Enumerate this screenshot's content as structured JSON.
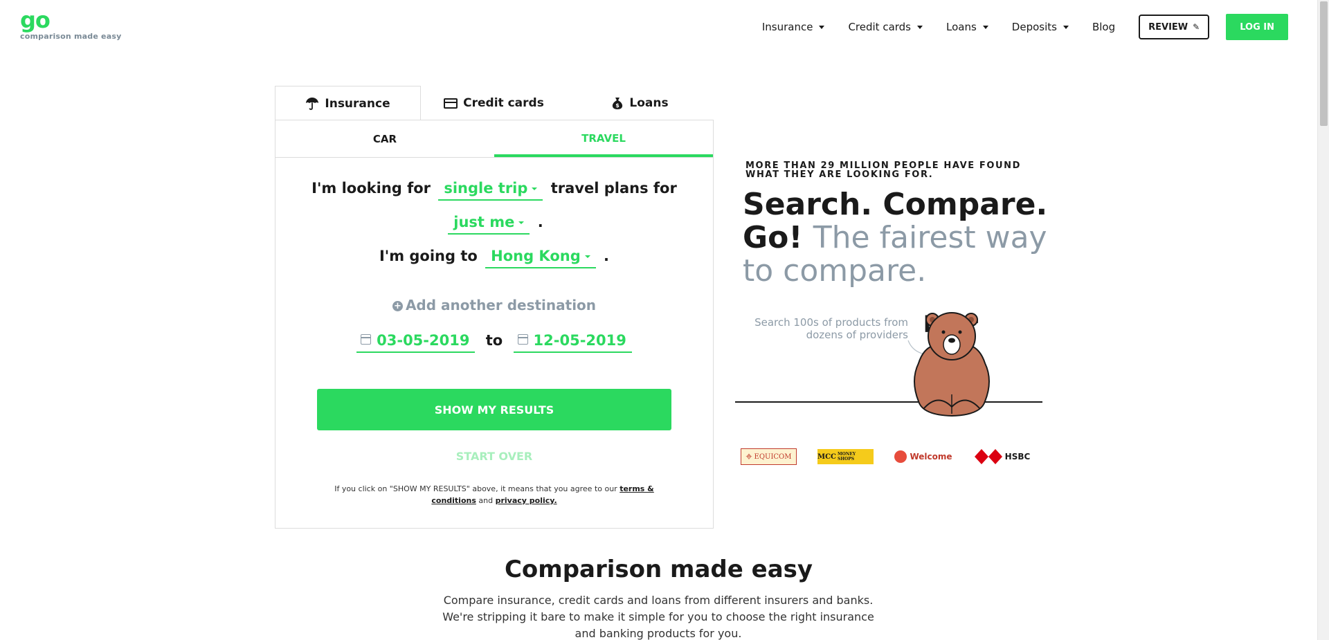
{
  "brand": {
    "logo_go": "go",
    "logo_bear": "bear",
    "tagline": "comparison made easy"
  },
  "nav": {
    "items": [
      {
        "label": "Insurance",
        "dropdown": true
      },
      {
        "label": "Credit cards",
        "dropdown": true
      },
      {
        "label": "Loans",
        "dropdown": true
      },
      {
        "label": "Deposits",
        "dropdown": true
      },
      {
        "label": "Blog",
        "dropdown": false
      }
    ],
    "review_label": "REVIEW",
    "login_label": "LOG IN"
  },
  "search": {
    "main_tabs": [
      {
        "label": "Insurance",
        "icon": "umbrella-icon",
        "active": true
      },
      {
        "label": "Credit cards",
        "icon": "credit-card-icon",
        "active": false
      },
      {
        "label": "Loans",
        "icon": "money-bag-icon",
        "active": false
      }
    ],
    "sub_tabs": [
      {
        "label": "CAR",
        "active": false
      },
      {
        "label": "TRAVEL",
        "active": true
      }
    ],
    "sentence1_prefix": "I'm looking for",
    "trip_type": "single trip",
    "sentence1_suffix": "travel plans for",
    "travellers": "just me",
    "sentence2_suffix": ".",
    "sentence3_prefix": "I'm going to",
    "destination": "Hong Kong",
    "sentence3_suffix": ".",
    "add_destination": "Add another destination",
    "start_date": "03-05-2019",
    "to_label": "to",
    "end_date": "12-05-2019",
    "submit_label": "SHOW MY RESULTS",
    "start_over_label": "START OVER",
    "legal_prefix": "If you click on \"SHOW MY RESULTS\" above, it means that you agree to our",
    "terms_link": "terms & conditions",
    "legal_and": "and",
    "privacy_link": "privacy policy."
  },
  "hero": {
    "kicker": "MORE THAN 29 MILLION PEOPLE HAVE FOUND WHAT THEY ARE LOOKING FOR.",
    "title_bold": "Search. Compare. Go!",
    "title_muted": "The fairest way to compare.",
    "note": "Search 100s of products from dozens of providers"
  },
  "partners": {
    "equicom": "EQUICOM",
    "mcc": "MCC",
    "mcc_sub": "MONEY SHOPS",
    "welcome": "Welcome",
    "hsbc": "HSBC"
  },
  "comparison": {
    "title": "Comparison made easy",
    "text": "Compare insurance, credit cards and loans from different insurers and banks. We're stripping it bare to make it simple for you to choose the right insurance and banking products for you."
  },
  "colors": {
    "brand_green": "#2bd95f",
    "muted_gray": "#8c9aa6"
  }
}
